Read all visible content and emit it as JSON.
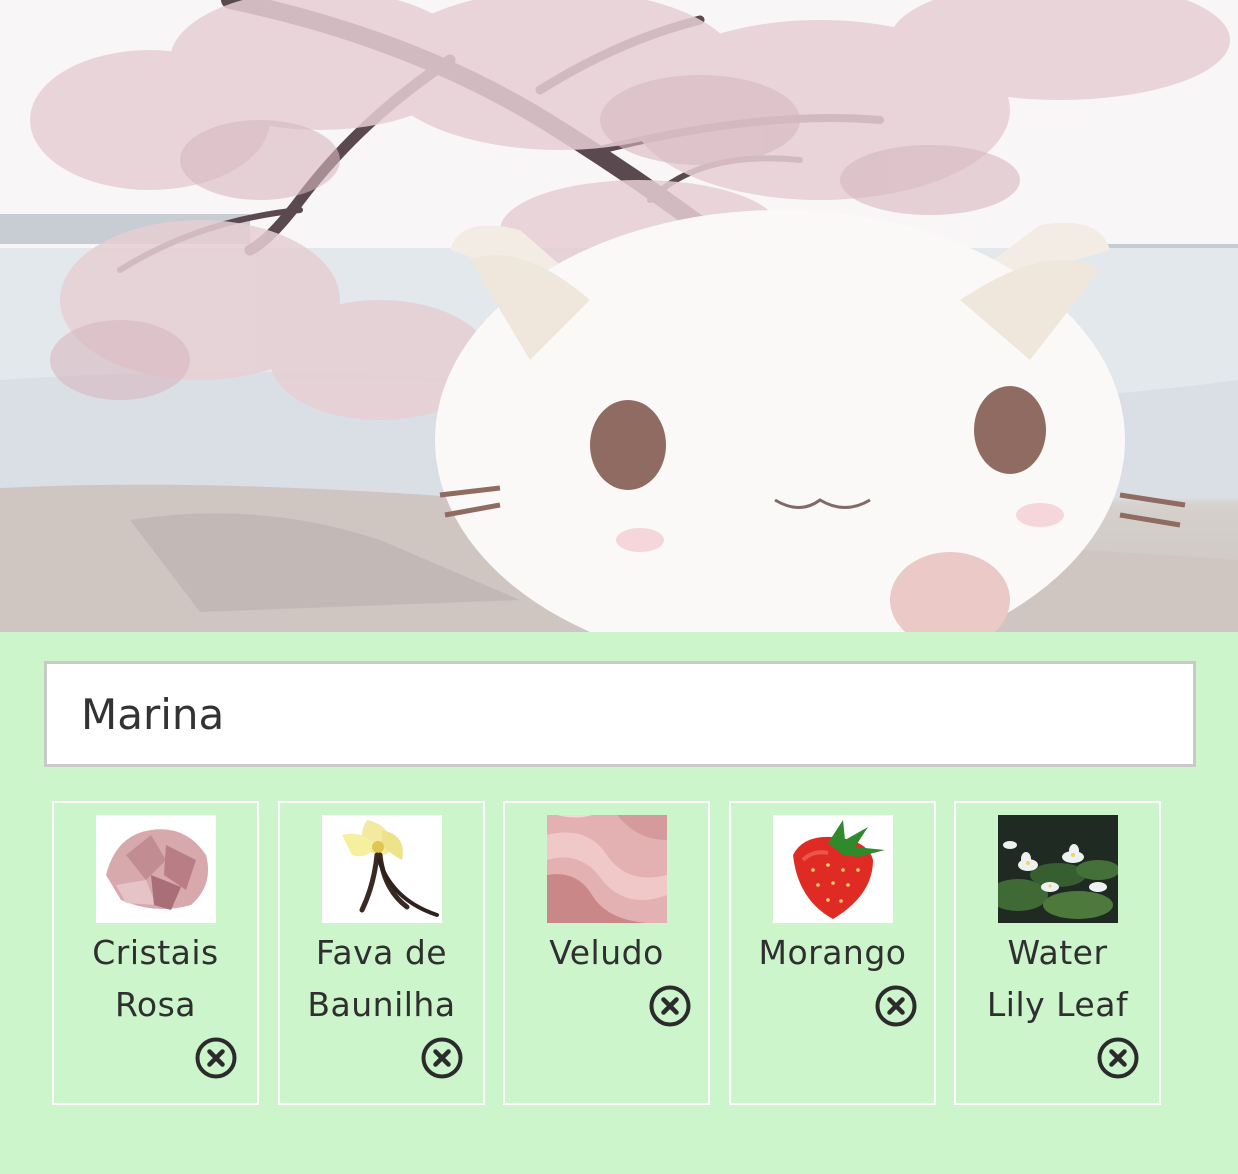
{
  "header": {
    "photo_icon": "cat-plush-photo"
  },
  "profile": {
    "name_value": "Marina"
  },
  "notes": [
    {
      "line1": "Cristais",
      "line2": "Rosa",
      "icon": "pink-crystal"
    },
    {
      "line1": "Fava de",
      "line2": "Baunilha",
      "icon": "vanilla-flower"
    },
    {
      "line1": "Veludo",
      "line2": "",
      "icon": "pink-velvet"
    },
    {
      "line1": "Morango",
      "line2": "",
      "icon": "strawberry"
    },
    {
      "line1": "Water",
      "line2": "Lily Leaf",
      "icon": "water-lily"
    }
  ],
  "colors": {
    "panel_bg": "#ccf5cb",
    "card_border": "#ffffff",
    "remove_icon": "#2b2b2b"
  }
}
